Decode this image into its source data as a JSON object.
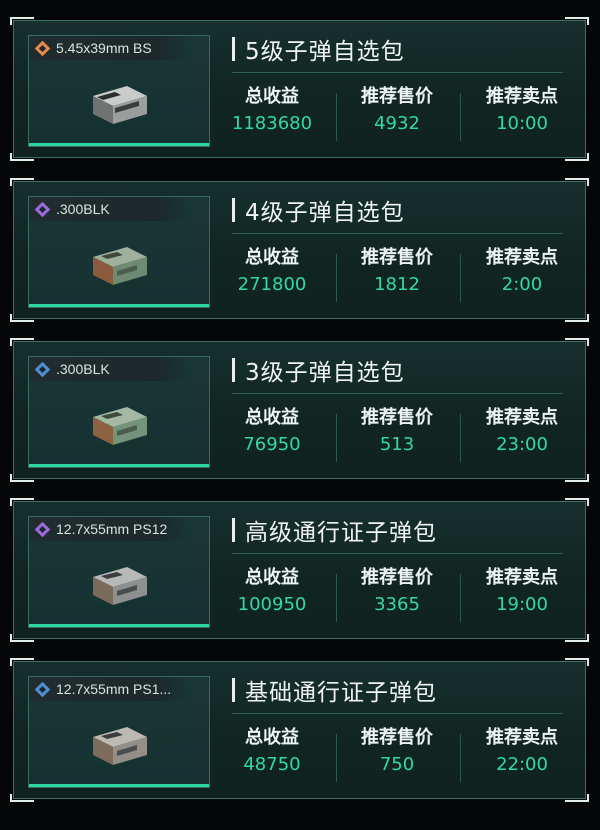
{
  "labels": {
    "total": "总收益",
    "price": "推荐售价",
    "time": "推荐卖点"
  },
  "cards": [
    {
      "ammo": "5.45x39mm BS",
      "rarity": "orange",
      "title": "5级子弹自选包",
      "total": "1183680",
      "price": "4932",
      "time": "10:00",
      "box_color": "#8e9391"
    },
    {
      "ammo": ".300BLK",
      "rarity": "purple",
      "title": "4级子弹自选包",
      "total": "271800",
      "price": "1812",
      "time": "2:00",
      "box_color": "#7f8e7d"
    },
    {
      "ammo": ".300BLK",
      "rarity": "blue",
      "title": "3级子弹自选包",
      "total": "76950",
      "price": "513",
      "time": "23:00",
      "box_color": "#7c9181"
    },
    {
      "ammo": "12.7x55mm PS12",
      "rarity": "purple",
      "title": "高级通行证子弹包",
      "total": "100950",
      "price": "3365",
      "time": "19:00",
      "box_color": "#8a8f8d"
    },
    {
      "ammo": "12.7x55mm PS1...",
      "rarity": "blue",
      "title": "基础通行证子弹包",
      "total": "48750",
      "price": "750",
      "time": "22:00",
      "box_color": "#8f8d88"
    }
  ],
  "colors": {
    "accent_green": "#33d9a0",
    "rarity_orange": "#e8894a",
    "rarity_purple": "#9a6bde",
    "rarity_blue": "#4d8fd6"
  }
}
